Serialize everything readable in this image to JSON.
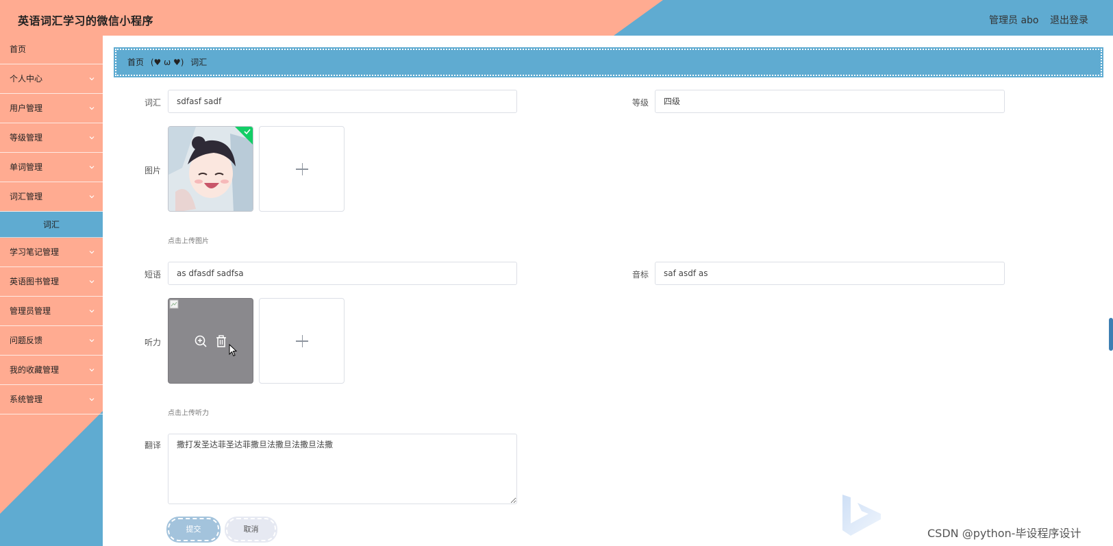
{
  "header": {
    "title": "英语词汇学习的微信小程序",
    "admin": "管理员 abo",
    "logout": "退出登录"
  },
  "sidebar": {
    "items": [
      {
        "label": "首页"
      },
      {
        "label": "个人中心"
      },
      {
        "label": "用户管理"
      },
      {
        "label": "等级管理"
      },
      {
        "label": "单词管理"
      },
      {
        "label": "词汇管理"
      },
      {
        "label": "学习笔记管理"
      },
      {
        "label": "英语图书管理"
      },
      {
        "label": "管理员管理"
      },
      {
        "label": "问题反馈"
      },
      {
        "label": "我的收藏管理"
      },
      {
        "label": "系统管理"
      }
    ],
    "active_sub": "词汇"
  },
  "breadcrumb": {
    "home": "首页",
    "separator": "(♥ ω ♥)",
    "current": "词汇"
  },
  "form": {
    "word_label": "词汇",
    "word_value": "sdfasf sadf",
    "level_label": "等级",
    "level_value": "四级",
    "image_label": "图片",
    "image_hint": "点击上传图片",
    "phrase_label": "短语",
    "phrase_value": "as dfasdf sadfsa",
    "phonetic_label": "音标",
    "phonetic_value": "saf asdf as",
    "audio_label": "听力",
    "audio_hint": "点击上传听力",
    "translation_label": "翻译",
    "translation_value": "撒打发圣达菲圣达菲撒旦法撒旦法撒旦法撒",
    "submit": "提交",
    "cancel": "取消"
  },
  "watermark": "CSDN @python-毕设程序设计",
  "colors": {
    "salmon": "#ffab91",
    "blue": "#5fabd1",
    "success": "#13ce66"
  }
}
